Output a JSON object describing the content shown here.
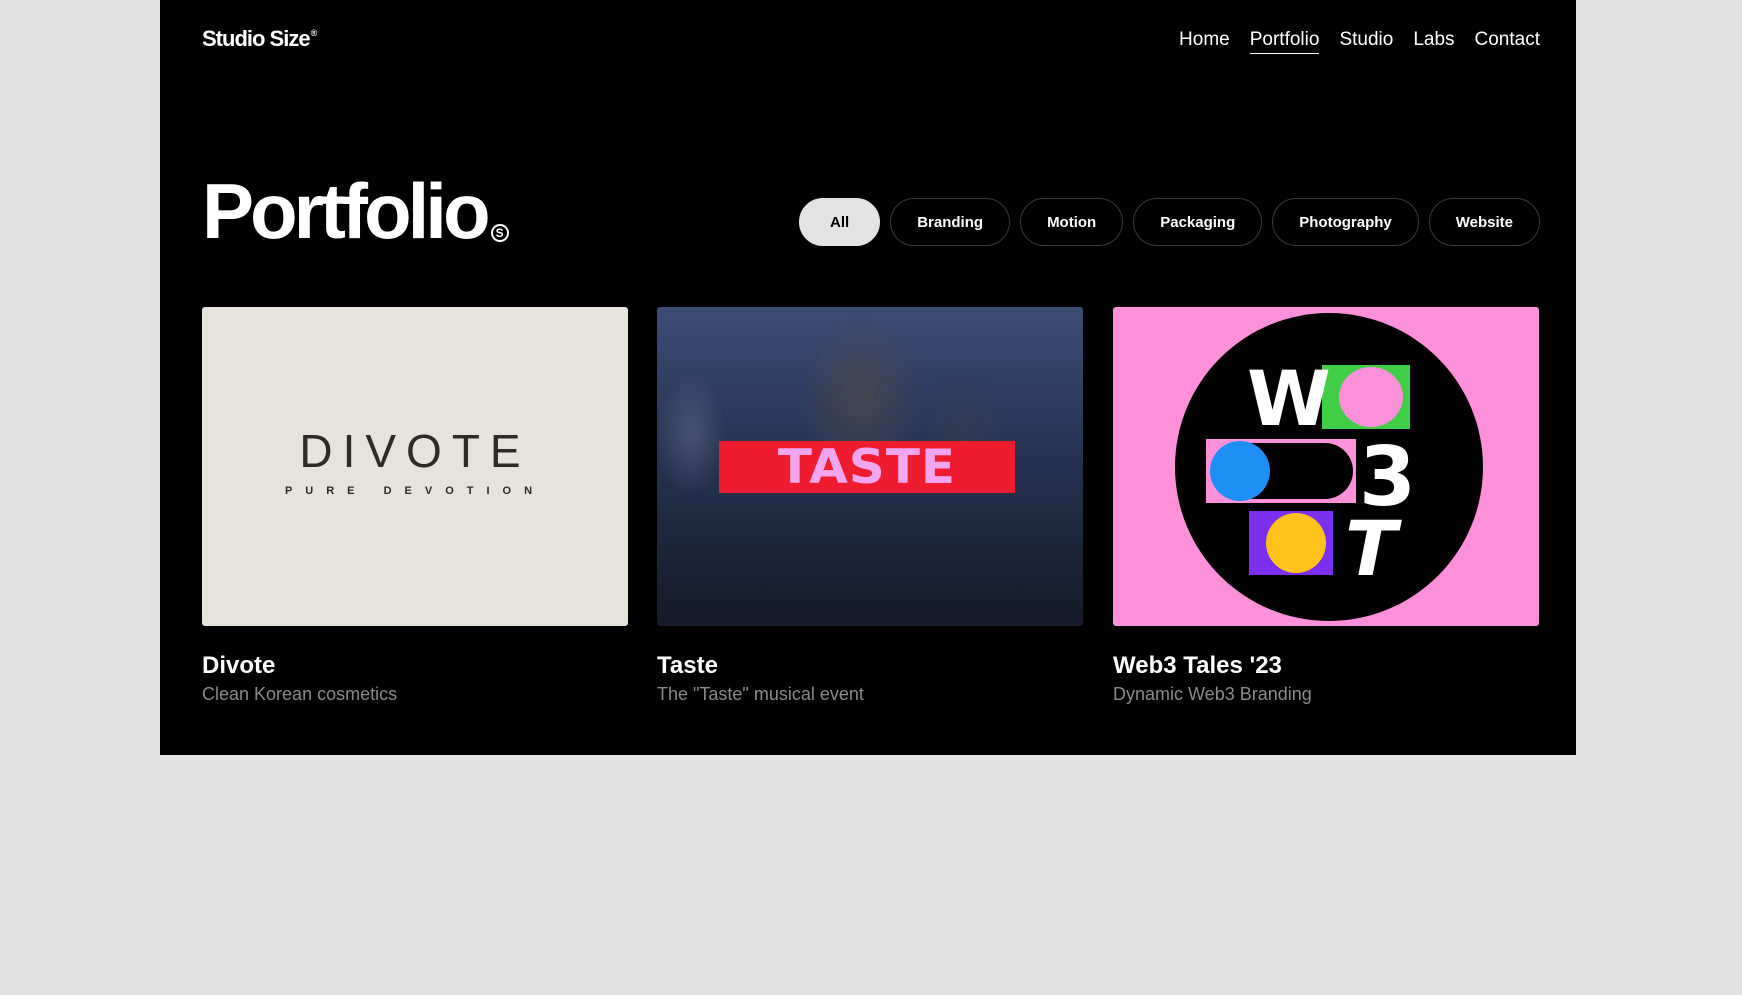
{
  "header": {
    "logo": "Studio Size",
    "logo_mark": "®",
    "nav": [
      "Home",
      "Portfolio",
      "Studio",
      "Labs",
      "Contact"
    ],
    "active_nav": "Portfolio"
  },
  "page": {
    "title": "Portfolio",
    "title_mark": "S"
  },
  "filters": {
    "items": [
      "All",
      "Branding",
      "Motion",
      "Packaging",
      "Photography",
      "Website"
    ],
    "active": "All"
  },
  "projects": [
    {
      "title": "Divote",
      "subtitle": "Clean Korean cosmetics",
      "image_text": "DIVOTE",
      "image_tagline": "PURE DEVOTION",
      "image_bg": "#e6e3dc"
    },
    {
      "title": "Taste",
      "subtitle": "The \"Taste\" musical event",
      "image_text": "TASTE",
      "image_bg": "#263452",
      "banner_color": "#ee1c2e",
      "banner_text_color": "#f2a6ef"
    },
    {
      "title": "Web3 Tales '23",
      "subtitle": "Dynamic Web3 Branding",
      "image_letters": [
        "W",
        "3",
        "T"
      ],
      "image_bg": "#ff90d9"
    }
  ],
  "colors": {
    "background": "#000000",
    "page_outer": "#e2e2e2",
    "subtitle": "#8a8a8a",
    "pill_active": "#e3e3e3"
  }
}
